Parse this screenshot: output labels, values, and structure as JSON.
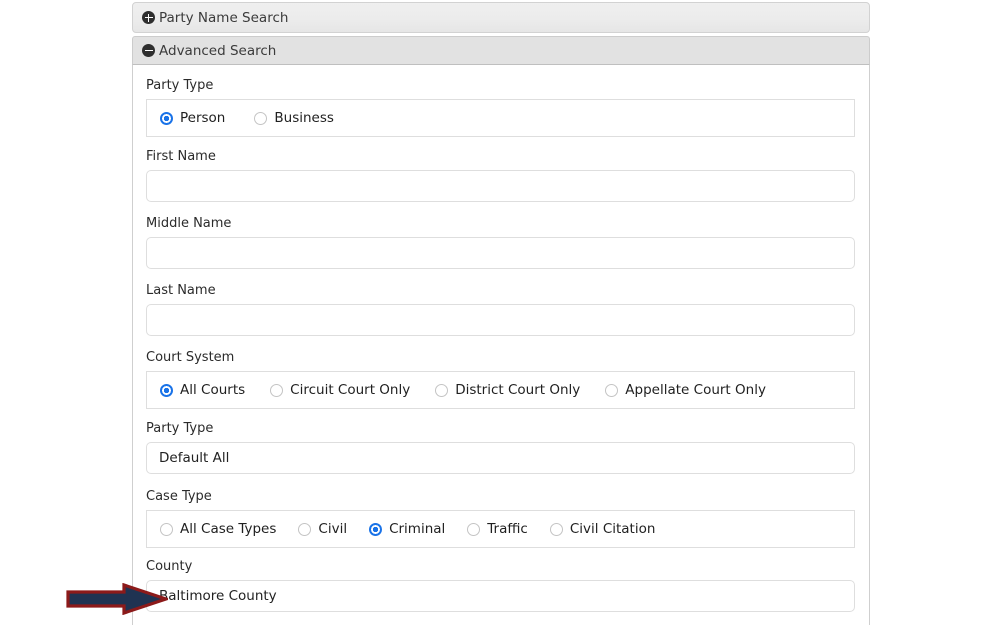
{
  "accordions": [
    {
      "label": "Party Name Search",
      "icon": "plus-icon",
      "state": "collapsed"
    },
    {
      "label": "Advanced Search",
      "icon": "minus-icon",
      "state": "expanded"
    }
  ],
  "form": {
    "party_type_radio": {
      "label": "Party Type",
      "options": [
        {
          "label": "Person",
          "selected": true
        },
        {
          "label": "Business",
          "selected": false
        }
      ]
    },
    "first_name": {
      "label": "First Name",
      "value": "",
      "placeholder": ""
    },
    "middle_name": {
      "label": "Middle Name",
      "value": "",
      "placeholder": ""
    },
    "last_name": {
      "label": "Last Name",
      "value": "",
      "placeholder": ""
    },
    "court_system": {
      "label": "Court System",
      "options": [
        {
          "label": "All Courts",
          "selected": true
        },
        {
          "label": "Circuit Court Only",
          "selected": false
        },
        {
          "label": "District Court Only",
          "selected": false
        },
        {
          "label": "Appellate Court Only",
          "selected": false
        }
      ]
    },
    "party_type_select": {
      "label": "Party Type",
      "value": "Default All"
    },
    "case_type": {
      "label": "Case Type",
      "options": [
        {
          "label": "All Case Types",
          "selected": false
        },
        {
          "label": "Civil",
          "selected": false
        },
        {
          "label": "Criminal",
          "selected": true
        },
        {
          "label": "Traffic",
          "selected": false
        },
        {
          "label": "Civil Citation",
          "selected": false
        }
      ]
    },
    "county": {
      "label": "County",
      "value": "Baltimore County"
    }
  },
  "annotation": {
    "type": "arrow",
    "direction": "right",
    "fill_color": "#1f3352",
    "border_color": "#8c1a1a",
    "points_at": "county-input"
  },
  "colors": {
    "radio_selected": "#1a73e8",
    "header_collapsed_bg": "#ececec",
    "header_expanded_bg": "#e2e2e2",
    "input_border": "#dedede",
    "panel_border": "#cfcfcf"
  }
}
